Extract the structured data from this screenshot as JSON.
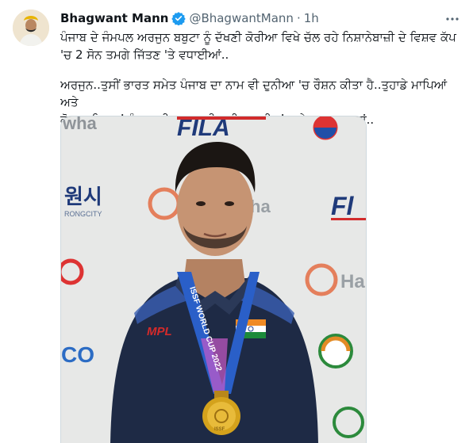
{
  "tweet": {
    "author_name": "Bhagwant Mann",
    "handle": "@BhagwantMann",
    "separator": "·",
    "time": "1h",
    "text_line1": "ਪੰਜਾਬ ਦੇ ਜੰਮਪਲ ਅਰਜੁਨ ਬਬੁਟਾ ਨੂੰ ਦੱਖਣੀ ਕੋਰੀਆ ਵਿਖੇ ਚੱਲ ਰਹੇ ਨਿਸ਼ਾਨੇਬਾਜ਼ੀ ਦੇ ਵਿਸ਼ਵ ਕੱਪ",
    "text_line2": "'ਚ 2 ਸੋਨ ਤਮਗੇ ਜਿੱਤਣ 'ਤੇ ਵਧਾਈਆਂ..",
    "text_line3": "ਅਰਜੁਨ..ਤੁਸੀਂ ਭਾਰਤ ਸਮੇਤ ਪੰਜਾਬ ਦਾ ਨਾਮ ਵੀ ਦੁਨੀਆ 'ਚ ਰੌਸ਼ਨ ਕੀਤਾ ਹੈ..ਤੁਹਾਡੇ ਮਾਪਿਆਂ ਅਤੇ",
    "text_line4": "ਕੋਚ ਸਾਹਿਬਾਨਾਂ ਨੂੰ ਤੁਹਾਡੀ ਕਾਮਯਾਬੀ ਲਈ ਵਧਾਈਆਂ ਅਤੇ ਸ਼ੁਭਕਾਮਨਾਵਾਂ.."
  },
  "photo": {
    "backdrop_texts": [
      "wha",
      "FILA",
      "원시",
      "RONGCITY",
      "ha",
      "Fl",
      "Ha",
      "CO"
    ],
    "jersey_logo": "MPL",
    "lanyard_text": "ISSF WORLD CUP 2022",
    "medal_text": "ISSF"
  },
  "icons": {
    "verified": "verified-badge-icon",
    "more": "more-options-icon"
  },
  "colors": {
    "verified_blue": "#1d9bf0",
    "text": "#0f1419",
    "secondary": "#536471",
    "jersey": "#1e2a45",
    "medal_gold": "#d4a21c"
  }
}
